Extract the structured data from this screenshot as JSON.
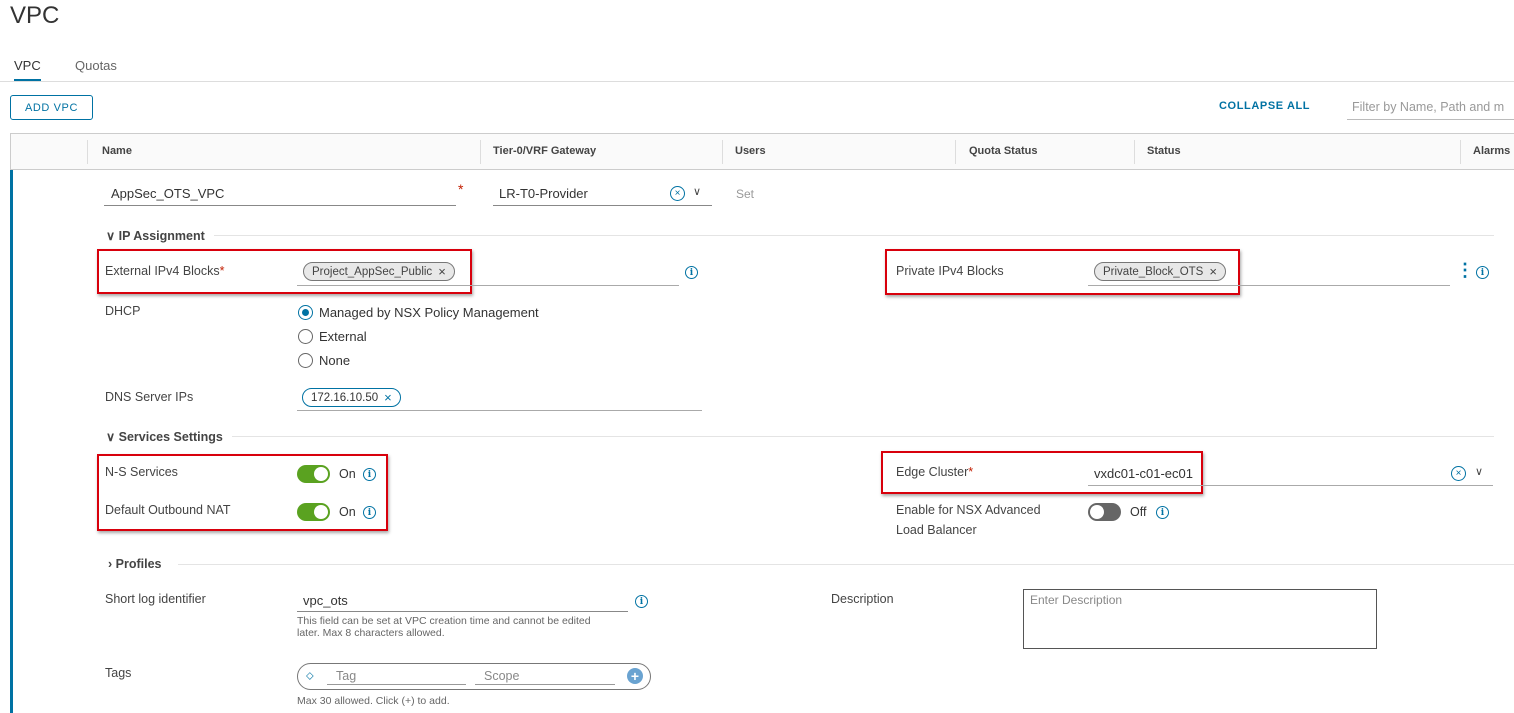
{
  "page": {
    "title": "VPC"
  },
  "tabs": [
    {
      "label": "VPC",
      "active": true
    },
    {
      "label": "Quotas",
      "active": false
    }
  ],
  "toolbar": {
    "add_label": "ADD VPC",
    "collapse_label": "COLLAPSE ALL",
    "filter_placeholder": "Filter by Name, Path and m"
  },
  "grid": {
    "columns": [
      "Name",
      "Tier-0/VRF Gateway",
      "Users",
      "Quota Status",
      "Status",
      "Alarms"
    ]
  },
  "row": {
    "name_value": "AppSec_OTS_VPC",
    "gateway_value": "LR-T0-Provider",
    "users_link": "Set"
  },
  "ip_assignment": {
    "header": "IP Assignment",
    "external_label": "External IPv4 Blocks",
    "external_chip": "Project_AppSec_Public",
    "private_label": "Private IPv4 Blocks",
    "private_chip": "Private_Block_OTS",
    "dhcp_label": "DHCP",
    "dhcp_options": [
      "Managed by NSX Policy Management",
      "External",
      "None"
    ],
    "dhcp_selected": 0,
    "dns_label": "DNS Server IPs",
    "dns_chip": "172.16.10.50"
  },
  "services": {
    "header": "Services Settings",
    "ns_label": "N-S Services",
    "ns_state": "On",
    "nat_label": "Default Outbound NAT",
    "nat_state": "On",
    "edge_label": "Edge Cluster",
    "edge_value": "vxdc01-c01-ec01",
    "alb_label_1": "Enable for NSX Advanced",
    "alb_label_2": "Load Balancer",
    "alb_state": "Off"
  },
  "profiles": {
    "header": "Profiles"
  },
  "misc": {
    "log_label": "Short log identifier",
    "log_value": "vpc_ots",
    "log_help_1": "This field can be set at VPC creation time and cannot be edited",
    "log_help_2": "later. Max 8 characters allowed.",
    "desc_label": "Description",
    "desc_placeholder": "Enter Description",
    "tags_label": "Tags",
    "tag_placeholder": "Tag",
    "scope_placeholder": "Scope",
    "tags_help": "Max 30 allowed. Click (+) to add."
  },
  "colors": {
    "accent": "#0072a3",
    "highlight": "#d8000c",
    "toggle_on": "#5aa220"
  }
}
